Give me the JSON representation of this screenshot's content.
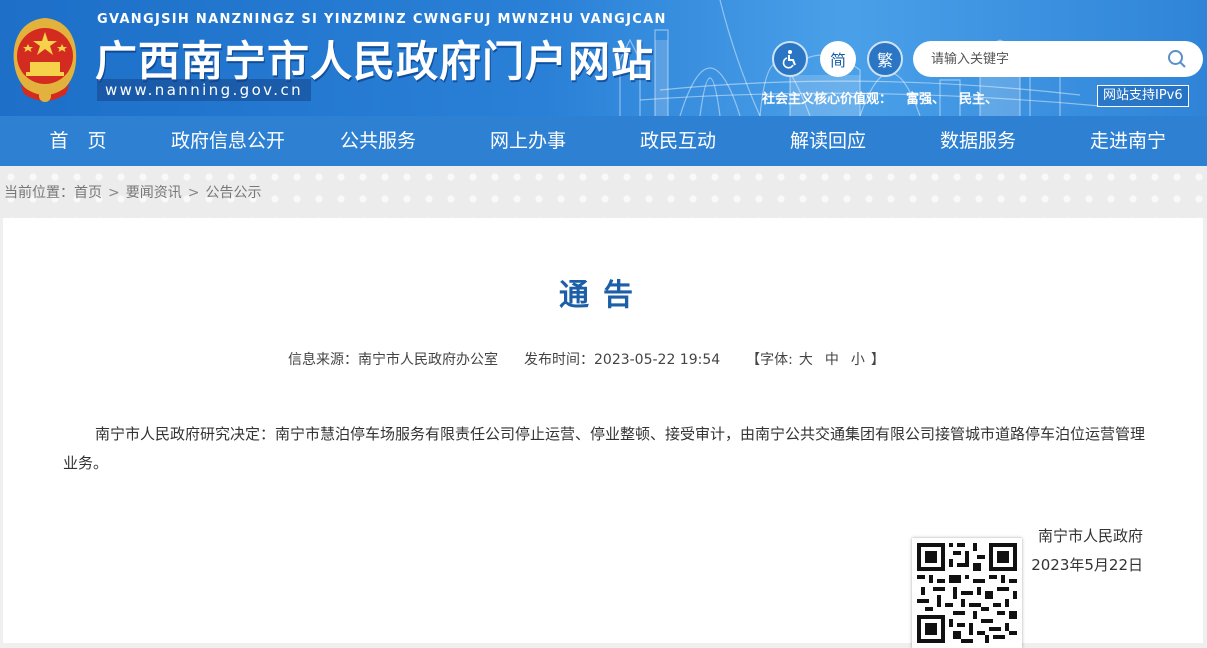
{
  "header": {
    "pinyin": "GVANGJSIH NANZNINGZ SI YINZMINZ CWNGFUJ MWNZHU VANGJCAN",
    "title": "广西南宁市人民政府门户网站",
    "url": "www.nanning.gov.cn",
    "accessibility_icon": "accessibility-icon",
    "simplified_label": "简",
    "traditional_label": "繁",
    "search_placeholder": "请输入关键字",
    "core_values_prefix": "社会主义核心价值观：",
    "core_values": [
      "富强、",
      "民主、"
    ],
    "ipv6_label": "网站支持IPv6",
    "brand_blue": "#2e80d2"
  },
  "nav": {
    "items": [
      "首　页",
      "政府信息公开",
      "公共服务",
      "网上办事",
      "政民互动",
      "解读回应",
      "数据服务",
      "走进南宁"
    ]
  },
  "breadcrumb": {
    "prefix": "当前位置：",
    "items": [
      "首页",
      "要闻资讯",
      "公告公示"
    ],
    "separator": ">"
  },
  "article": {
    "title": "通告",
    "source_label": "信息来源：",
    "source": "南宁市人民政府办公室",
    "date_label": "发布时间：",
    "date": "2023-05-22 19:54",
    "font_label": "【字体:",
    "font_sizes": [
      "大",
      "中",
      "小"
    ],
    "font_close": "】",
    "body": "南宁市人民政府研究决定：南宁市慧泊停车场服务有限责任公司停止运营、停业整顿、接受审计，由南宁公共交通集团有限公司接管城市道路停车泊位运营管理业务。",
    "signature_org": "南宁市人民政府",
    "signature_date": "2023年5月22日",
    "title_color": "#1c5fa7"
  }
}
